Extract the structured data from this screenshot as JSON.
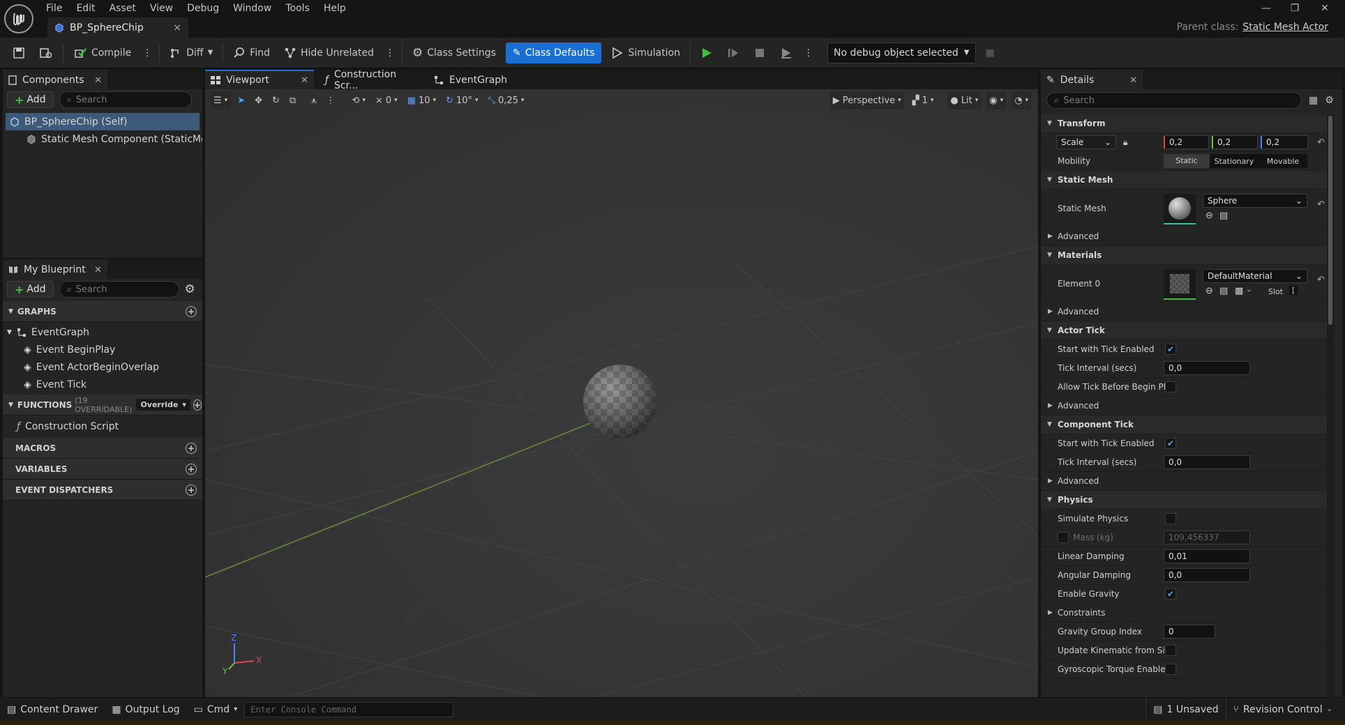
{
  "menu": [
    "File",
    "Edit",
    "Asset",
    "View",
    "Debug",
    "Window",
    "Tools",
    "Help"
  ],
  "document_tab": {
    "title": "BP_SphereChip",
    "close": "×"
  },
  "parent_class": {
    "label": "Parent class:",
    "value": "Static Mesh Actor"
  },
  "toolbar": {
    "compile": "Compile",
    "diff": "Diff",
    "find": "Find",
    "hide_unrelated": "Hide Unrelated",
    "class_settings": "Class Settings",
    "class_defaults": "Class Defaults",
    "simulation": "Simulation",
    "debug_object": "No debug object selected"
  },
  "components_panel": {
    "title": "Components",
    "add": "Add",
    "search_placeholder": "Search",
    "items": [
      "BP_SphereChip (Self)",
      "Static Mesh Component (StaticMeshCo"
    ]
  },
  "my_blueprint": {
    "title": "My Blueprint",
    "add": "Add",
    "search_placeholder": "Search",
    "graphs_header": "GRAPHS",
    "event_graph": "EventGraph",
    "events": [
      "Event BeginPlay",
      "Event ActorBeginOverlap",
      "Event Tick"
    ],
    "functions_header": "FUNCTIONS",
    "functions_count": "(19 OVERRIDABLE)",
    "override": "Override",
    "construction_script": "Construction Script",
    "macros": "MACROS",
    "variables": "VARIABLES",
    "event_dispatchers": "EVENT DISPATCHERS"
  },
  "editor_tabs": [
    "Viewport",
    "Construction Scr...",
    "EventGraph"
  ],
  "viewport_toolbar": {
    "rotation_snap_count": "0",
    "grid_snap": "10",
    "angle_snap": "10°",
    "scale_snap": "0,25",
    "perspective": "Perspective",
    "camera_speed": "1",
    "lit": "Lit"
  },
  "axis_labels": {
    "z": "Z",
    "y": "Y",
    "x": "X"
  },
  "details": {
    "title": "Details",
    "search_placeholder": "Search",
    "sections": {
      "transform": "Transform",
      "static_mesh": "Static Mesh",
      "materials": "Materials",
      "actor_tick": "Actor Tick",
      "component_tick": "Component Tick",
      "physics": "Physics"
    },
    "scale_label": "Scale",
    "scale": [
      "0,2",
      "0,2",
      "0,2"
    ],
    "mobility_label": "Mobility",
    "mobility_options": [
      "Static",
      "Stationary",
      "Movable"
    ],
    "static_mesh_label": "Static Mesh",
    "static_mesh_value": "Sphere",
    "advanced": "Advanced",
    "element0_label": "Element 0",
    "material_value": "DefaultMaterial",
    "slot": "Slot",
    "slot_value": "[",
    "actor_tick": {
      "start_enabled_label": "Start with Tick Enabled",
      "tick_interval_label": "Tick Interval (secs)",
      "tick_interval": "0,0",
      "allow_before_begin_label": "Allow Tick Before Begin Pl..."
    },
    "component_tick": {
      "start_enabled_label": "Start with Tick Enabled",
      "tick_interval_label": "Tick Interval (secs)",
      "tick_interval": "0,0"
    },
    "physics": {
      "simulate_label": "Simulate Physics",
      "mass_label": "Mass (kg)",
      "mass": "109,456337",
      "linear_damping_label": "Linear Damping",
      "linear_damping": "0,01",
      "angular_damping_label": "Angular Damping",
      "angular_damping": "0,0",
      "enable_gravity_label": "Enable Gravity",
      "constraints": "Constraints",
      "gravity_group_label": "Gravity Group Index",
      "gravity_group": "0",
      "update_kinematic_label": "Update Kinematic from Si...",
      "gyroscopic_label": "Gyroscopic Torque Enabled"
    }
  },
  "status_bar": {
    "content_drawer": "Content Drawer",
    "output_log": "Output Log",
    "cmd": "Cmd",
    "console_placeholder": "Enter Console Command",
    "unsaved": "1 Unsaved",
    "revision_control": "Revision Control"
  },
  "colors": {
    "accent": "#1a6fd4",
    "play_green": "#3ec13e",
    "checkbox": "#4ea4ff"
  }
}
